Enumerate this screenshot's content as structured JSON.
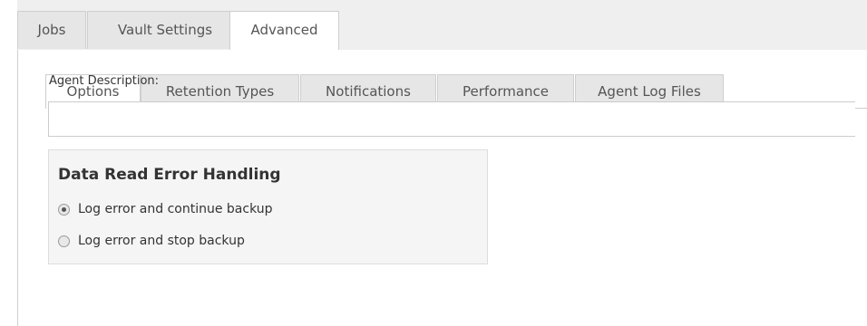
{
  "outer_tabs": [
    {
      "label": "Jobs",
      "active": false
    },
    {
      "label": "Vault Settings",
      "active": false
    },
    {
      "label": "Advanced",
      "active": true
    }
  ],
  "inner_tabs": [
    {
      "label": "Options",
      "active": true
    },
    {
      "label": "Retention Types",
      "active": false
    },
    {
      "label": "Notifications",
      "active": false
    },
    {
      "label": "Performance",
      "active": false
    },
    {
      "label": "Agent Log Files",
      "active": false
    }
  ],
  "agent_description": {
    "label": "Agent Description:",
    "value": ""
  },
  "error_handling": {
    "title": "Data Read Error Handling",
    "options": [
      {
        "label": "Log error and continue backup",
        "selected": true
      },
      {
        "label": "Log error and stop backup",
        "selected": false
      }
    ]
  }
}
